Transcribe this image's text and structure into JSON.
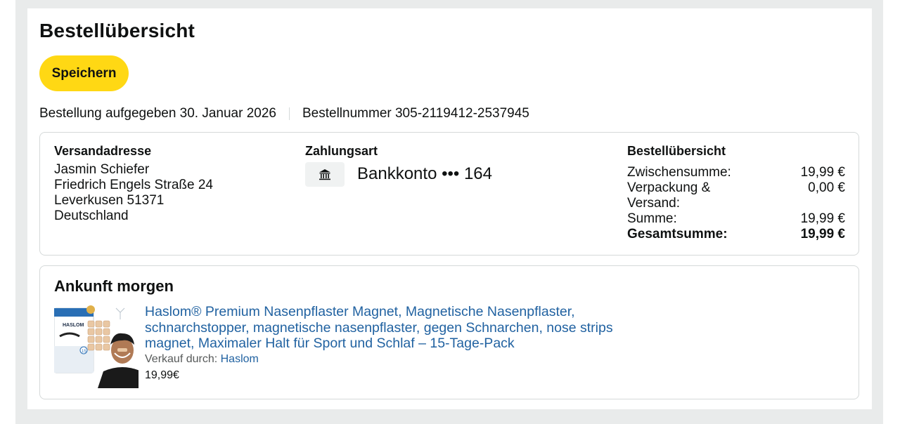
{
  "page": {
    "title": "Bestellübersicht",
    "save_label": "Speichern"
  },
  "order_meta": {
    "placed": "Bestellung aufgegeben 30. Januar 2026",
    "number": "Bestellnummer 305-2119412-2537945"
  },
  "shipping": {
    "heading": "Versandadresse",
    "lines": [
      "Jasmin Schiefer",
      "Friedrich Engels Straße 24",
      "Leverkusen 51371",
      "Deutschland"
    ]
  },
  "payment": {
    "heading": "Zahlungsart",
    "icon": "bank-icon",
    "method": "Bankkonto ••• 164"
  },
  "summary": {
    "heading": "Bestellübersicht",
    "rows": [
      {
        "label": "Zwischensumme:",
        "value": "19,99 €"
      },
      {
        "label": "Verpackung & Versand:",
        "value": "0,00 €"
      },
      {
        "label": "Summe:",
        "value": "19,99 €"
      },
      {
        "label": "Gesamtsumme:",
        "value": "19,99 €"
      }
    ]
  },
  "shipment": {
    "arrival": "Ankunft morgen",
    "product": {
      "title": "Haslom® Premium Nasenpflaster Magnet, Magnetische Nasenpflaster, schnarchstopper, magnetische nasenpflaster, gegen Schnarchen, nose strips magnet, Maximaler Halt für Sport und Schlaf – 15-Tage-Pack",
      "seller_prefix": "Verkauf durch:",
      "seller_name": "Haslom",
      "price": "19,99€",
      "image_brand": "HASLOM",
      "image_count": "15"
    }
  }
}
